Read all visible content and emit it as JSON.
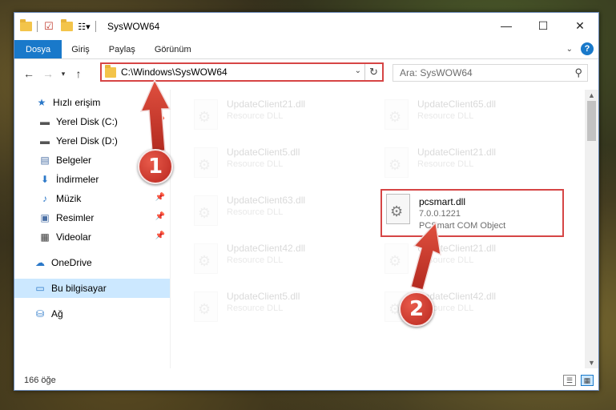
{
  "window": {
    "title": "SysWOW64",
    "controls": {
      "minimize": "—",
      "maximize": "☐",
      "close": "✕"
    }
  },
  "ribbon": {
    "tabs": [
      "Dosya",
      "Giriş",
      "Paylaş",
      "Görünüm"
    ],
    "active_tab": "Dosya",
    "accent_color": "#1979ca"
  },
  "address": {
    "path": "C:\\Windows\\SysWOW64",
    "search_placeholder": "Ara: SysWOW64"
  },
  "sidebar": {
    "items": [
      {
        "label": "Hızlı erişim",
        "icon": "star-icon",
        "pinned": false
      },
      {
        "label": "Yerel Disk (C:)",
        "icon": "drive-icon",
        "pinned": true
      },
      {
        "label": "Yerel Disk (D:)",
        "icon": "drive-icon",
        "pinned": true
      },
      {
        "label": "Belgeler",
        "icon": "documents-icon",
        "pinned": true
      },
      {
        "label": "İndirmeler",
        "icon": "downloads-icon",
        "pinned": true
      },
      {
        "label": "Müzik",
        "icon": "music-icon",
        "pinned": true
      },
      {
        "label": "Resimler",
        "icon": "pictures-icon",
        "pinned": true
      },
      {
        "label": "Videolar",
        "icon": "videos-icon",
        "pinned": true
      },
      {
        "label": "OneDrive",
        "icon": "cloud-icon",
        "pinned": false
      },
      {
        "label": "Bu bilgisayar",
        "icon": "computer-icon",
        "pinned": false,
        "selected": true
      },
      {
        "label": "Ağ",
        "icon": "network-icon",
        "pinned": false
      }
    ]
  },
  "files": [
    {
      "name": "UpdateClient21.dll",
      "type": "Resource DLL"
    },
    {
      "name": "UpdateClient65.dll",
      "type": "Resource DLL"
    },
    {
      "name": "UpdateClient5.dll",
      "type": "Resource DLL"
    },
    {
      "name": "UpdateClient21.dll",
      "type": "Resource DLL"
    },
    {
      "name": "UpdateClient63.dll",
      "type": "Resource DLL"
    },
    {
      "name": "pcsmart.dll",
      "version": "7.0.0.1221",
      "type": "PCSmart COM Object"
    },
    {
      "name": "UpdateClient42.dll",
      "type": "Resource DLL"
    },
    {
      "name": "UpdateClient21.dll",
      "type": "Resource DLL"
    },
    {
      "name": "UpdateClient5.dll",
      "type": "Resource DLL"
    },
    {
      "name": "UpdateClient42.dll",
      "type": "Resource DLL"
    }
  ],
  "status": {
    "item_count": "166 öğe"
  },
  "annotations": {
    "badge1": "1",
    "badge2": "2",
    "highlight_color": "#d64545"
  }
}
